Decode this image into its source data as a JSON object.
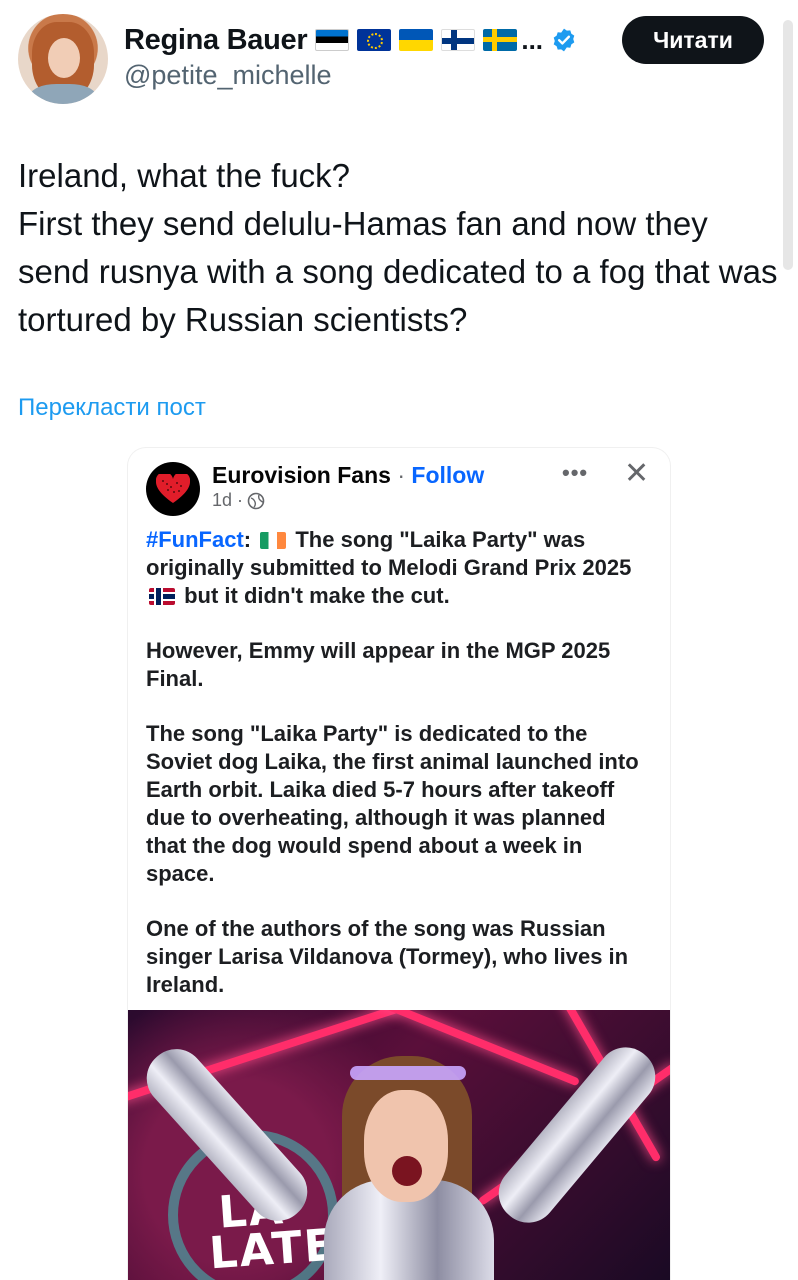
{
  "author": {
    "display_name": "Regina Bauer",
    "flags": [
      "estonia-flag",
      "eu-flag",
      "ukraine-flag",
      "finland-flag",
      "sweden-flag"
    ],
    "truncation": "...",
    "handle": "@petite_michelle",
    "verified": true
  },
  "follow_button": {
    "label": "Читати"
  },
  "tweet": {
    "lines": [
      "Ireland, what the fuck?",
      "First they send delulu-Hamas fan and now they send rusnya with a song dedicated to a fog that was tortured by Russian scientists?"
    ],
    "translate_label": "Перекласти пост"
  },
  "embedded_post": {
    "page_name": "Eurovision Fans",
    "separator": "·",
    "follow_label": "Follow",
    "time": "1d ·",
    "more_label": "•••",
    "close_label": "✕",
    "hashtag": "#FunFact",
    "p1_a": ": ",
    "p1_b": " The song \"Laika Party\" was originally submitted to Melodi Grand Prix 2025 ",
    "p1_c": " but it didn't make the cut.",
    "p2": "However, Emmy will appear in the MGP 2025 Final.",
    "p3": "The song \"Laika Party\" is dedicated to the Soviet dog Laika, the first animal launched into Earth orbit. Laika died 5-7 hours after takeoff due to overheating, although it was planned that the dog would spend about a week in space.",
    "p4": "One of the authors of the song was Russian singer Larisa Vildanova (Tormey), who lives in Ireland.",
    "photo_text_1": "LA",
    "photo_text_2": "LATE"
  },
  "colors": {
    "link_blue": "#1d9bf0",
    "fb_blue": "#0866ff",
    "button_bg": "#0f1419",
    "secondary_text": "#536471"
  }
}
